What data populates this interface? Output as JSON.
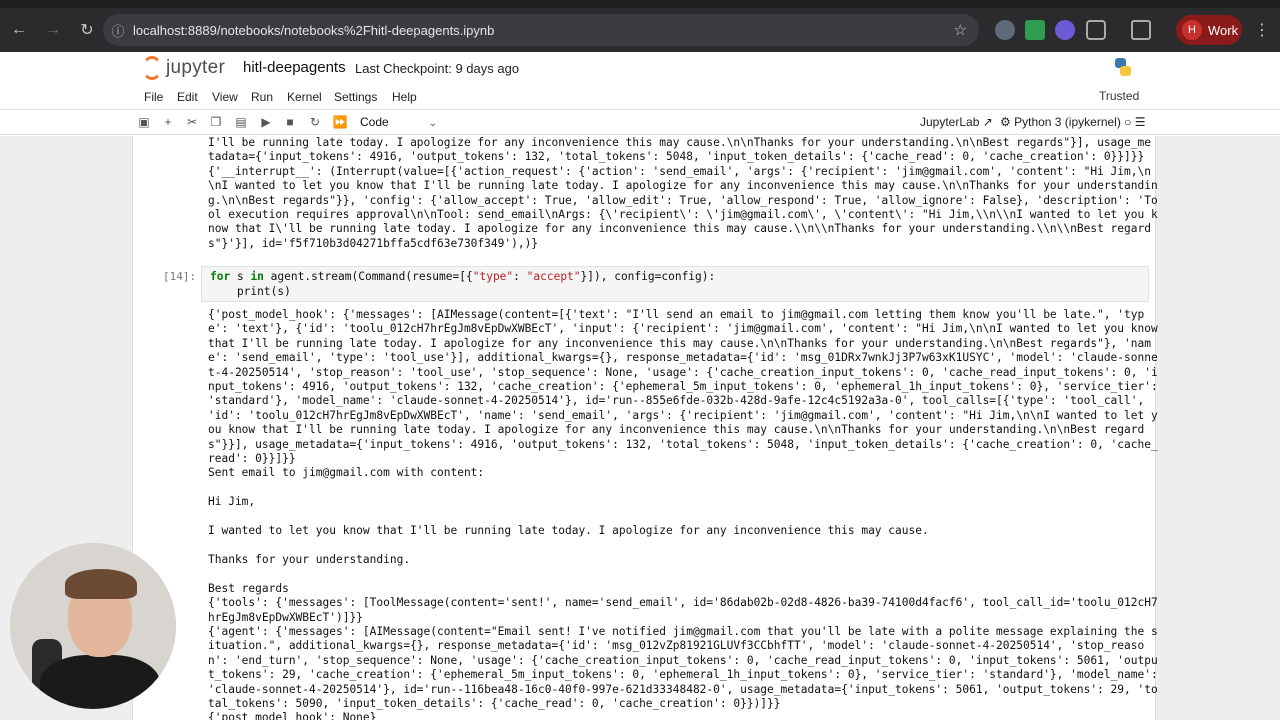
{
  "browser": {
    "url": "localhost:8889/notebooks/notebooks%2Fhitl-deepagents.ipynb",
    "profile_initial": "H",
    "profile_label": "Work"
  },
  "header": {
    "logo_text": "jupyter",
    "notebook_title": "hitl-deepagents",
    "checkpoint": "Last Checkpoint: 9 days ago"
  },
  "menu": [
    "File",
    "Edit",
    "View",
    "Run",
    "Kernel",
    "Settings",
    "Help"
  ],
  "trusted": "Trusted",
  "toolbar": {
    "cell_type": "Code",
    "jupyterlab": "JupyterLab",
    "kernel": "Python 3 (ipykernel)"
  },
  "cells": {
    "prev_output": [
      "I'll be running late today. I apologize for any inconvenience this may cause.\\n\\nThanks for your understanding.\\n\\nBest regards\"}], usage_me",
      "tadata={'input_tokens': 4916, 'output_tokens': 132, 'total_tokens': 5048, 'input_token_details': {'cache_read': 0, 'cache_creation': 0}}]}}",
      "{'__interrupt__': (Interrupt(value=[{'action_request': {'action': 'send_email', 'args': {'recipient': 'jim@gmail.com', 'content': \"Hi Jim,\\n",
      "\\nI wanted to let you know that I'll be running late today. I apologize for any inconvenience this may cause.\\n\\nThanks for your understandin",
      "g.\\n\\nBest regards\"}}, 'config': {'allow_accept': True, 'allow_edit': True, 'allow_respond': True, 'allow_ignore': False}, 'description': 'To",
      "ol execution requires approval\\n\\nTool: send_email\\nArgs: {\\'recipient\\': \\'jim@gmail.com\\', \\'content\\': \"Hi Jim,\\\\n\\\\nI wanted to let you k",
      "now that I\\'ll be running late today. I apologize for any inconvenience this may cause.\\\\n\\\\nThanks for your understanding.\\\\n\\\\nBest regard",
      "s\"}'}], id='f5f710b3d04271bffa5cdf63e730f349'),)}"
    ],
    "prompt": "[14]:",
    "code_line1_kw": "for",
    "code_line1_a": " s ",
    "code_line1_in": "in",
    "code_line1_b": " agent.stream(Command(resume=[{",
    "code_line1_s1": "\"type\"",
    "code_line1_c": ": ",
    "code_line1_s2": "\"accept\"",
    "code_line1_d": "}]), config=config):",
    "code_line2": "    print(s)",
    "output": [
      "{'post_model_hook': {'messages': [AIMessage(content=[{'text': \"I'll send an email to jim@gmail.com letting them know you'll be late.\", 'typ",
      "e': 'text'}, {'id': 'toolu_012cH7hrEgJm8vEpDwXWBEcT', 'input': {'recipient': 'jim@gmail.com', 'content': \"Hi Jim,\\n\\nI wanted to let you know",
      "that I'll be running late today. I apologize for any inconvenience this may cause.\\n\\nThanks for your understanding.\\n\\nBest regards\"}, 'nam",
      "e': 'send_email', 'type': 'tool_use'}], additional_kwargs={}, response_metadata={'id': 'msg_01DRx7wnkJj3P7w63xK1USYC', 'model': 'claude-sonne",
      "t-4-20250514', 'stop_reason': 'tool_use', 'stop_sequence': None, 'usage': {'cache_creation_input_tokens': 0, 'cache_read_input_tokens': 0, 'i",
      "nput_tokens': 4916, 'output_tokens': 132, 'cache_creation': {'ephemeral_5m_input_tokens': 0, 'ephemeral_1h_input_tokens': 0}, 'service_tier':",
      "'standard'}, 'model_name': 'claude-sonnet-4-20250514'}, id='run--855e6fde-032b-428d-9afe-12c4c5192a3a-0', tool_calls=[{'type': 'tool_call',",
      "'id': 'toolu_012cH7hrEgJm8vEpDwXWBEcT', 'name': 'send_email', 'args': {'recipient': 'jim@gmail.com', 'content': \"Hi Jim,\\n\\nI wanted to let y",
      "ou know that I'll be running late today. I apologize for any inconvenience this may cause.\\n\\nThanks for your understanding.\\n\\nBest regard",
      "s\"}}], usage_metadata={'input_tokens': 4916, 'output_tokens': 132, 'total_tokens': 5048, 'input_token_details': {'cache_creation': 0, 'cache_",
      "read': 0}}]}}",
      "Sent email to jim@gmail.com with content:",
      "",
      "Hi Jim,",
      "",
      "I wanted to let you know that I'll be running late today. I apologize for any inconvenience this may cause.",
      "",
      "Thanks for your understanding.",
      "",
      "Best regards",
      "{'tools': {'messages': [ToolMessage(content='sent!', name='send_email', id='86dab02b-02d8-4826-ba39-74100d4facf6', tool_call_id='toolu_012cH7",
      "hrEgJm8vEpDwXWBEcT')]}}",
      "{'agent': {'messages': [AIMessage(content=\"Email sent! I've notified jim@gmail.com that you'll be late with a polite message explaining the s",
      "ituation.\", additional_kwargs={}, response_metadata={'id': 'msg_012vZp81921GLUVf3CCbhfTT', 'model': 'claude-sonnet-4-20250514', 'stop_reaso",
      "n': 'end_turn', 'stop_sequence': None, 'usage': {'cache_creation_input_tokens': 0, 'cache_read_input_tokens': 0, 'input_tokens': 5061, 'outpu",
      "t_tokens': 29, 'cache_creation': {'ephemeral_5m_input_tokens': 0, 'ephemeral_1h_input_tokens': 0}, 'service_tier': 'standard'}, 'model_name':",
      "'claude-sonnet-4-20250514'}, id='run--116bea48-16c0-40f0-997e-621d33348482-0', usage_metadata={'input_tokens': 5061, 'output_tokens': 29, 'to",
      "tal_tokens': 5090, 'input_token_details': {'cache_read': 0, 'cache_creation': 0}})]}}",
      "{'post_model_hook': None}"
    ]
  }
}
